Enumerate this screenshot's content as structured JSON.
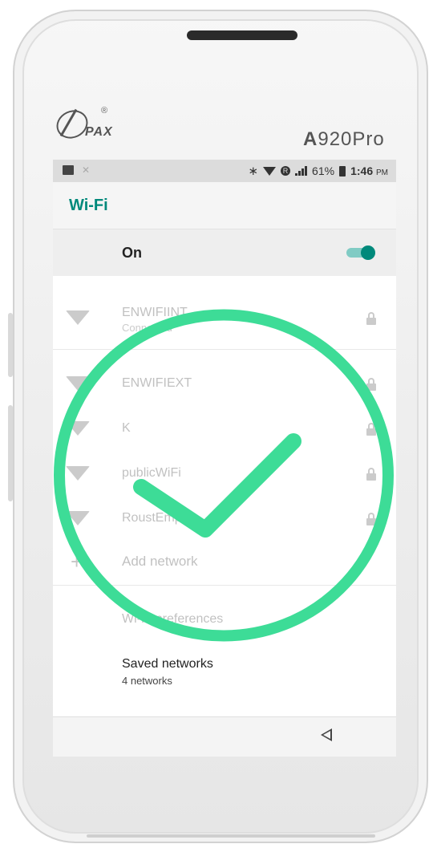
{
  "device": {
    "brand": "PAX",
    "brand_mark": "®",
    "model_bold": "A",
    "model_rest": "920Pro"
  },
  "status_bar": {
    "battery": "61%",
    "time": "1:46",
    "ampm": "PM"
  },
  "app_bar": {
    "title": "Wi-Fi"
  },
  "wifi_toggle": {
    "label": "On",
    "enabled": true
  },
  "networks": [
    {
      "name": "ENWIFIINT",
      "status": "Connected",
      "secured": true
    },
    {
      "name": "ENWIFIEXT",
      "status": "",
      "secured": true
    },
    {
      "name": "K",
      "status": "",
      "secured": true
    },
    {
      "name": "publicWiFi",
      "status": "",
      "secured": true
    },
    {
      "name": "RoustEmp",
      "status": "",
      "secured": true
    }
  ],
  "add_network": {
    "label": "Add network"
  },
  "preferences": {
    "label": "Wi-Fi preferences"
  },
  "saved_networks": {
    "label": "Saved networks",
    "count_text": "4 networks"
  },
  "overlay": {
    "icon": "check-circle-icon",
    "color": "#3ddc97"
  },
  "colors": {
    "accent": "#00897b",
    "accent_light": "#80cbc4"
  }
}
